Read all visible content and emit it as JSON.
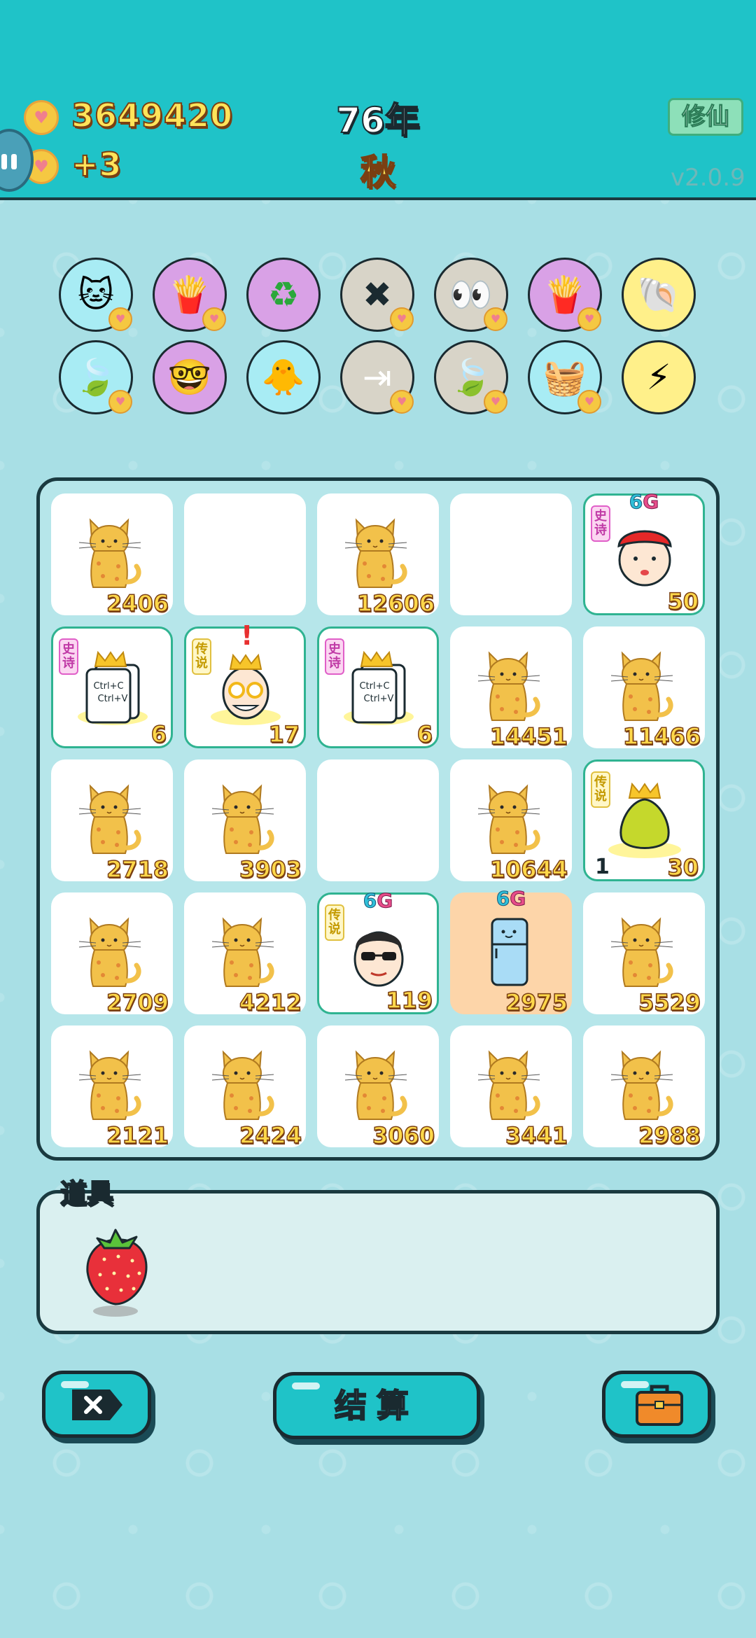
{
  "header": {
    "coins": "3649420",
    "income": "+3",
    "year": "76年",
    "season": "秋",
    "mode_button": "修仙",
    "version": "v2.0.9"
  },
  "skills": [
    {
      "name": "cat-face-icon"
    },
    {
      "name": "french-fries-icon"
    },
    {
      "name": "recycle-icon"
    },
    {
      "name": "remove-tag-icon"
    },
    {
      "name": "cat-eyes-icon"
    },
    {
      "name": "french-fries-icon"
    },
    {
      "name": "shell-icon"
    },
    {
      "name": "leaf-icon"
    },
    {
      "name": "math-student-icon"
    },
    {
      "name": "chick-egg-icon"
    },
    {
      "name": "skip-icon"
    },
    {
      "name": "leaf-icon"
    },
    {
      "name": "fruit-basket-icon"
    },
    {
      "name": "lightning-icon"
    }
  ],
  "board": {
    "cells": [
      {
        "type": "cat",
        "value": "2406"
      },
      {
        "type": "empty"
      },
      {
        "type": "cat",
        "value": "12606"
      },
      {
        "type": "empty"
      },
      {
        "type": "boy-red-hat",
        "value": "50",
        "tag": "史诗",
        "badge": "6G"
      },
      {
        "type": "ctrl-cv",
        "value": "6",
        "tag": "史诗",
        "card": "Ctrl+C\nCtrl+V"
      },
      {
        "type": "king-glasses",
        "value": "17",
        "tag": "传说",
        "alert": "!"
      },
      {
        "type": "ctrl-cv",
        "value": "6",
        "tag": "史诗",
        "card": "Ctrl+C\nCtrl+V"
      },
      {
        "type": "cat",
        "value": "14451"
      },
      {
        "type": "cat",
        "value": "11466"
      },
      {
        "type": "cat",
        "value": "2718"
      },
      {
        "type": "cat",
        "value": "3903"
      },
      {
        "type": "empty"
      },
      {
        "type": "cat",
        "value": "10644"
      },
      {
        "type": "pomelo",
        "value": "30",
        "tag": "传说",
        "left": "1"
      },
      {
        "type": "cat",
        "value": "2709"
      },
      {
        "type": "cat",
        "value": "4212"
      },
      {
        "type": "sunglasses-man",
        "value": "119",
        "tag": "传说",
        "badge": "6G"
      },
      {
        "type": "fridge",
        "value": "2975",
        "badge": "6G"
      },
      {
        "type": "cat",
        "value": "5529"
      },
      {
        "type": "cat",
        "value": "2121"
      },
      {
        "type": "cat",
        "value": "2424"
      },
      {
        "type": "cat",
        "value": "3060"
      },
      {
        "type": "cat",
        "value": "3441"
      },
      {
        "type": "cat",
        "value": "2988"
      }
    ]
  },
  "items": {
    "label": "道具",
    "list": [
      {
        "name": "strawberry-icon"
      }
    ]
  },
  "buttons": {
    "remove_icon": "remove-tag-icon",
    "settle": "结算",
    "bag_icon": "briefcase-icon"
  },
  "colors": {
    "header_bg": "#1fc3c8",
    "body_bg": "#a8e0e6",
    "number_yellow": "#ffd84a",
    "number_outline": "#7a3f12",
    "highlight_green": "#2fb391"
  }
}
